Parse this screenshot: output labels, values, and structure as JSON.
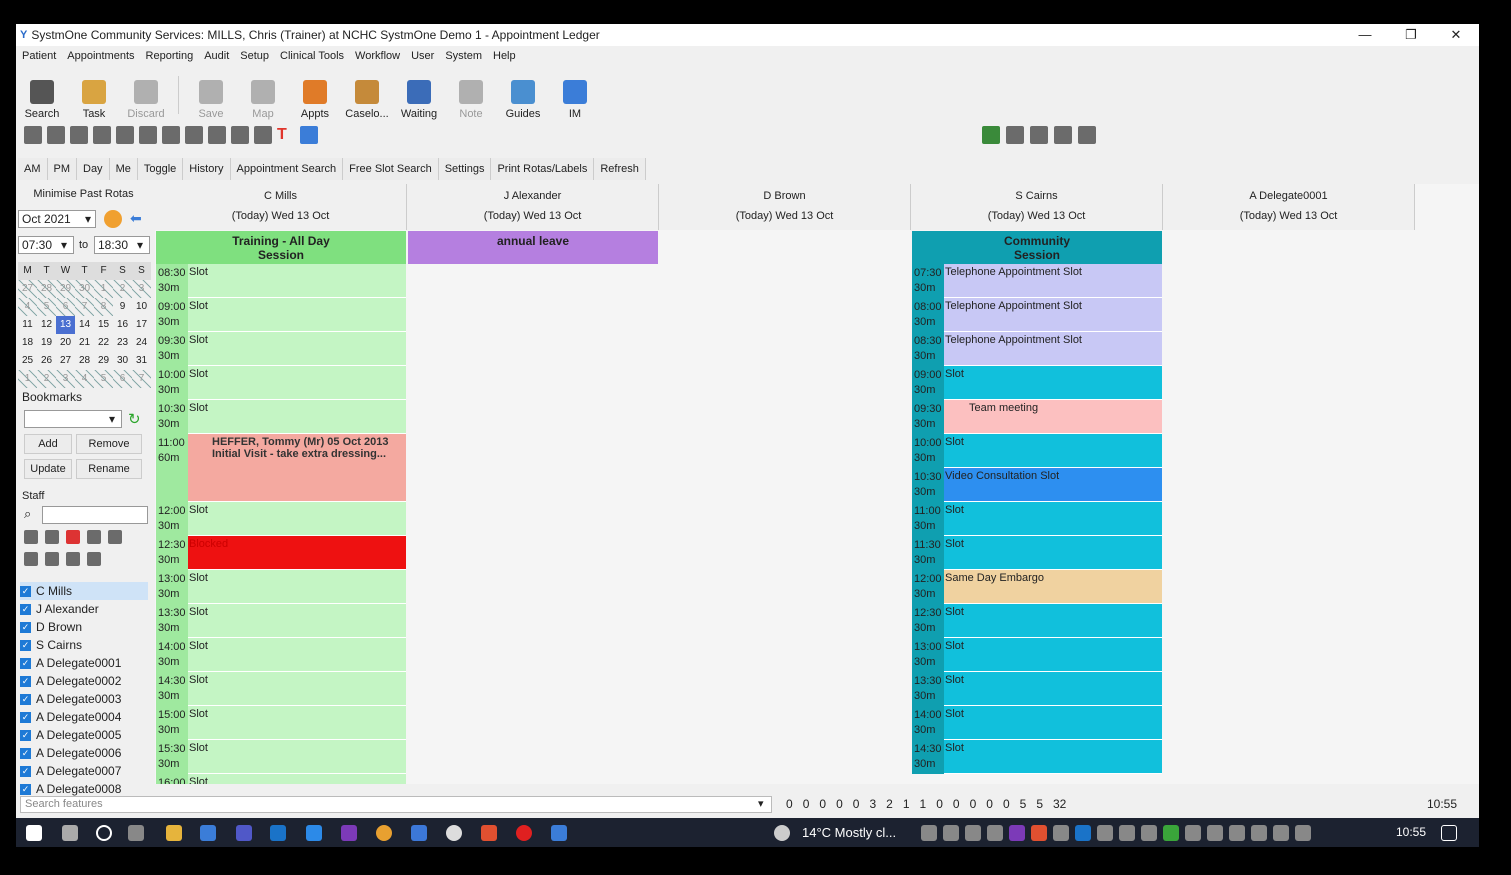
{
  "window": {
    "title": "SystmOne Community Services: MILLS, Chris (Trainer) at NCHC SystmOne Demo 1 - Appointment Ledger"
  },
  "menu": [
    "Patient",
    "Appointments",
    "Reporting",
    "Audit",
    "Setup",
    "Clinical Tools",
    "Workflow",
    "User",
    "System",
    "Help"
  ],
  "toolbar": [
    {
      "label": "Search",
      "icon": "magnifier-icon",
      "enabled": true
    },
    {
      "label": "Task",
      "icon": "task-icon",
      "enabled": true
    },
    {
      "label": "Discard",
      "icon": "trash-icon",
      "enabled": false
    },
    {
      "label": "Save",
      "icon": "save-icon",
      "enabled": false
    },
    {
      "label": "Map",
      "icon": "map-icon",
      "enabled": false
    },
    {
      "label": "Appts",
      "icon": "appointments-icon",
      "enabled": true
    },
    {
      "label": "Caselo...",
      "icon": "caseload-icon",
      "enabled": true
    },
    {
      "label": "Waiting",
      "icon": "waiting-icon",
      "enabled": true
    },
    {
      "label": "Note",
      "icon": "note-icon",
      "enabled": false
    },
    {
      "label": "Guides",
      "icon": "guides-icon",
      "enabled": true
    },
    {
      "label": "IM",
      "icon": "im-icon",
      "enabled": true
    }
  ],
  "buttons": [
    "AM",
    "PM",
    "Day",
    "Me",
    "Toggle",
    "History",
    "Appointment Search",
    "Free Slot Search",
    "Settings",
    "Print Rotas/Labels",
    "Refresh"
  ],
  "left": {
    "minimise": "Minimise Past Rotas",
    "month": "Oct 2021",
    "from": "07:30",
    "to_label": "to",
    "to": "18:30",
    "weekdays": [
      "M",
      "T",
      "W",
      "T",
      "F",
      "S",
      "S"
    ],
    "weeks": [
      [
        "27",
        "28",
        "29",
        "30",
        "1",
        "2",
        "3"
      ],
      [
        "4",
        "5",
        "6",
        "7",
        "8",
        "9",
        "10"
      ],
      [
        "11",
        "12",
        "13",
        "14",
        "15",
        "16",
        "17"
      ],
      [
        "18",
        "19",
        "20",
        "21",
        "22",
        "23",
        "24"
      ],
      [
        "25",
        "26",
        "27",
        "28",
        "29",
        "30",
        "31"
      ],
      [
        "1",
        "2",
        "3",
        "4",
        "5",
        "6",
        "7"
      ]
    ],
    "bookmarks": "Bookmarks",
    "add": "Add",
    "remove": "Remove",
    "update": "Update",
    "rename": "Rename",
    "staff": "Staff",
    "staff_list": [
      "C Mills",
      "J Alexander",
      "D Brown",
      "S Cairns",
      "A Delegate0001",
      "A Delegate0002",
      "A Delegate0003",
      "A Delegate0004",
      "A Delegate0005",
      "A Delegate0006",
      "A Delegate0007",
      "A Delegate0008"
    ]
  },
  "columns": [
    {
      "name": "C Mills",
      "date": "(Today) Wed 13 Oct",
      "band": "Training - All Day\nSession",
      "band_color": "#7fe07f"
    },
    {
      "name": "J Alexander",
      "date": "(Today) Wed 13 Oct",
      "band": "annual leave",
      "band_color": "#b57fe0"
    },
    {
      "name": "D Brown",
      "date": "(Today) Wed 13 Oct",
      "band": "",
      "band_color": ""
    },
    {
      "name": "S Cairns",
      "date": "(Today) Wed 13 Oct",
      "band": "Community\nSession",
      "band_color": "#0f9fb0"
    },
    {
      "name": "A Delegate0001",
      "date": "(Today) Wed 13 Oct",
      "band": "",
      "band_color": ""
    }
  ],
  "mills_slots": [
    {
      "t": "08:30",
      "d": "30m",
      "l": "Slot",
      "c": "#c4f5c4"
    },
    {
      "t": "09:00",
      "d": "30m",
      "l": "Slot",
      "c": "#c4f5c4"
    },
    {
      "t": "09:30",
      "d": "30m",
      "l": "Slot",
      "c": "#c4f5c4"
    },
    {
      "t": "10:00",
      "d": "30m",
      "l": "Slot",
      "c": "#c4f5c4"
    },
    {
      "t": "10:30",
      "d": "30m",
      "l": "Slot",
      "c": "#c4f5c4"
    },
    {
      "t": "11:00",
      "d": "60m",
      "l": "HEFFER, Tommy (Mr) 05 Oct 2013\nInitial Visit - take extra dressing...",
      "c": "#f4a9a0"
    },
    {
      "t": "12:00",
      "d": "30m",
      "l": "Slot",
      "c": "#c4f5c4"
    },
    {
      "t": "12:30",
      "d": "30m",
      "l": "Blocked",
      "c": "#ee1111"
    },
    {
      "t": "13:00",
      "d": "30m",
      "l": "Slot",
      "c": "#c4f5c4"
    },
    {
      "t": "13:30",
      "d": "30m",
      "l": "Slot",
      "c": "#c4f5c4"
    },
    {
      "t": "14:00",
      "d": "30m",
      "l": "Slot",
      "c": "#c4f5c4"
    },
    {
      "t": "14:30",
      "d": "30m",
      "l": "Slot",
      "c": "#c4f5c4"
    },
    {
      "t": "15:00",
      "d": "30m",
      "l": "Slot",
      "c": "#c4f5c4"
    },
    {
      "t": "15:30",
      "d": "30m",
      "l": "Slot",
      "c": "#c4f5c4"
    },
    {
      "t": "16:00",
      "d": "30m",
      "l": "Slot",
      "c": "#c4f5c4"
    }
  ],
  "cairns_slots": [
    {
      "t": "07:30",
      "d": "30m",
      "l": "Telephone Appointment Slot",
      "c": "#c8c8f5"
    },
    {
      "t": "08:00",
      "d": "30m",
      "l": "Telephone Appointment Slot",
      "c": "#c8c8f5"
    },
    {
      "t": "08:30",
      "d": "30m",
      "l": "Telephone Appointment Slot",
      "c": "#c8c8f5"
    },
    {
      "t": "09:00",
      "d": "30m",
      "l": "Slot",
      "c": "#11c0dc"
    },
    {
      "t": "09:30",
      "d": "30m",
      "l": "Team meeting",
      "c": "#fcc0c0"
    },
    {
      "t": "10:00",
      "d": "30m",
      "l": "Slot",
      "c": "#11c0dc"
    },
    {
      "t": "10:30",
      "d": "30m",
      "l": "Video Consultation Slot",
      "c": "#2d8ff0"
    },
    {
      "t": "11:00",
      "d": "30m",
      "l": "Slot",
      "c": "#11c0dc"
    },
    {
      "t": "11:30",
      "d": "30m",
      "l": "Slot",
      "c": "#11c0dc"
    },
    {
      "t": "12:00",
      "d": "30m",
      "l": "Same Day Embargo",
      "c": "#f0d2a0"
    },
    {
      "t": "12:30",
      "d": "30m",
      "l": "Slot",
      "c": "#11c0dc"
    },
    {
      "t": "13:00",
      "d": "30m",
      "l": "Slot",
      "c": "#11c0dc"
    },
    {
      "t": "13:30",
      "d": "30m",
      "l": "Slot",
      "c": "#11c0dc"
    },
    {
      "t": "14:00",
      "d": "30m",
      "l": "Slot",
      "c": "#11c0dc"
    },
    {
      "t": "14:30",
      "d": "30m",
      "l": "Slot",
      "c": "#11c0dc"
    }
  ],
  "status": {
    "search_placeholder": "Search features",
    "counts": [
      "0",
      "0",
      "0",
      "0",
      "0",
      "3",
      "2",
      "1",
      "1",
      "0",
      "0",
      "0",
      "0",
      "0",
      "5",
      "5",
      "32"
    ],
    "time": "10:55"
  },
  "taskbar": {
    "weather": "14°C  Mostly cl...",
    "time": "10:55"
  }
}
